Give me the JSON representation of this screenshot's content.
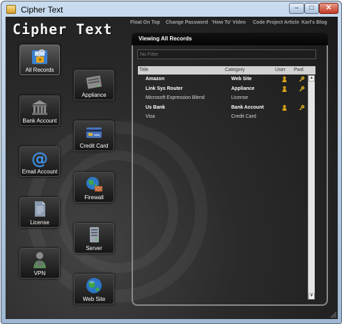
{
  "window": {
    "title": "Cipher Text",
    "controls": {
      "minimize": "–",
      "maximize": "□",
      "close": "✕"
    }
  },
  "app": {
    "title": "Cipher Text"
  },
  "top_links": [
    "Float On Top",
    "Change Password",
    "'How To' Video",
    "Code Project Article",
    "Karl's Blog"
  ],
  "categories": [
    {
      "label": "All Records",
      "icon": "unlocked-padlock-icon",
      "active": true
    },
    {
      "label": "Appliance",
      "icon": "router-icon",
      "active": false
    },
    {
      "label": "Bank Account",
      "icon": "bank-icon",
      "active": false
    },
    {
      "label": "Credit Card",
      "icon": "credit-card-icon",
      "active": false
    },
    {
      "label": "Email Account",
      "icon": "at-sign-icon",
      "active": false
    },
    {
      "label": "Firewall",
      "icon": "firewall-globe-icon",
      "active": false
    },
    {
      "label": "License",
      "icon": "document-icon",
      "active": false
    },
    {
      "label": "Server",
      "icon": "server-icon",
      "active": false
    },
    {
      "label": "VPN",
      "icon": "vpn-person-icon",
      "active": false
    },
    {
      "label": "Web Site",
      "icon": "globe-icon",
      "active": false
    }
  ],
  "panel": {
    "header": "Viewing All Records",
    "filter_placeholder": "No Filter",
    "columns": {
      "title": "Title",
      "category": "Category",
      "user": "User",
      "pwd": "Pwd"
    }
  },
  "records": [
    {
      "title": "Amazon",
      "category": "Web Site",
      "user": true,
      "pwd": true,
      "bold": true
    },
    {
      "title": "Link Sys Router",
      "category": "Appliance",
      "user": true,
      "pwd": true,
      "bold": true
    },
    {
      "title": "Microsoft Expression Blend",
      "category": "License",
      "user": false,
      "pwd": false,
      "bold": false
    },
    {
      "title": "Us Bank",
      "category": "Bank Account",
      "user": true,
      "pwd": true,
      "bold": true
    },
    {
      "title": "Visa",
      "category": "Credit Card",
      "user": false,
      "pwd": false,
      "bold": false
    }
  ],
  "colors": {
    "background": "#1f1f1f",
    "panel_border": "#8a8a8a",
    "grid_header": "#d2d2d2",
    "user_icon": "#d4a017",
    "pwd_icon": "#e0b020"
  }
}
